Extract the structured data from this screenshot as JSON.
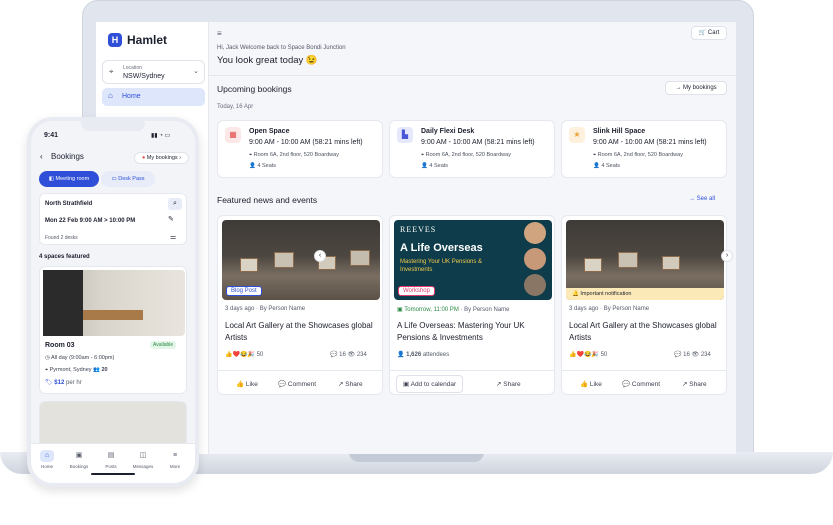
{
  "sidebar": {
    "app_name": "Hamlet",
    "logo_letter": "H",
    "location_label": "Location",
    "location_value": "NSW/Sydney",
    "nav_home": "Home"
  },
  "header": {
    "cart_label": "Cart",
    "greeting": "Hi, Jack Welcome back to Space Bondi Junction",
    "tagline": "You look great today 😉"
  },
  "bookings": {
    "title": "Upcoming bookings",
    "my_bookings": "My bookings",
    "date": "Today, 16 Apr",
    "items": [
      {
        "name": "Open Space",
        "time": "9:00 AM - 10:00 AM (58:21 mins left)",
        "room": "Room 6A, 2nd floor, 520 Boardway",
        "seats": "4 Seats",
        "icon": "building-icon",
        "color": "#e24b4b",
        "bg": "#fde8e8"
      },
      {
        "name": "Daily Flexi Desk",
        "time": "9:00 AM - 10:00 AM (58:21 mins left)",
        "room": "Room 6A, 2nd floor, 520 Boardway",
        "seats": "4 Seats",
        "icon": "desk-icon",
        "color": "#4a57d6",
        "bg": "#e6e8fb"
      },
      {
        "name": "Slink Hill Space",
        "time": "9:00 AM - 10:00 AM (58:21 mins left)",
        "room": "Room 6A, 2nd floor, 520 Boardway",
        "seats": "4 Seats",
        "icon": "star-icon",
        "color": "#e8a43a",
        "bg": "#fdf1de"
      }
    ]
  },
  "news": {
    "title": "Featured news and events",
    "see_all": "See all",
    "cards": [
      {
        "tag": "Blog Post",
        "meta": "3 days ago · By Person Name",
        "title": "Local Art Gallery at the Showcases global Artists",
        "reactions": "50",
        "comments": "16",
        "views": "234",
        "a1": "Like",
        "a2": "Comment",
        "a3": "Share"
      },
      {
        "tag": "Workshop",
        "meta_time": "Tomorrow, 11:00 PM",
        "meta": "· By Person Name",
        "title": "A Life Overseas: Mastering Your UK Pensions & Investments",
        "attendees": "1,626",
        "attendees_label": "attendees",
        "a1": "Add to calendar",
        "a2": "Share",
        "brand": "REEVES",
        "banner_title": "A Life Overseas",
        "banner_sub": "Mastering Your UK Pensions & Investments"
      },
      {
        "notice": "Important notification",
        "meta": "3 days ago · By Person Name",
        "title": "Local Art Gallery at the Showcases global Artists",
        "reactions": "50",
        "comments": "16",
        "views": "234",
        "a1": "Like",
        "a2": "Comment",
        "a3": "Share"
      }
    ]
  },
  "phone": {
    "time": "9:41",
    "title": "Bookings",
    "my_bookings": "My bookings",
    "tab_meeting": "Meeting room",
    "tab_desk": "Desk Pass",
    "store": "North Strathfield",
    "date_range": "Mon 22 Feb    9:00 AM > 10:00 PM",
    "found": "Found 2 desks",
    "featured": "4 spaces featured",
    "room": "Room 03",
    "available": "Available",
    "hours": "All day (9:00am - 6:00pm)",
    "place": "Pyrmont, Sydney",
    "capacity": "20",
    "price": "$12",
    "price_unit": "per hr",
    "nav": [
      "Home",
      "Bookings",
      "Posts",
      "Messages",
      "More"
    ]
  },
  "colors": {
    "accent": "#2f4fd8",
    "available": "#2a8a45",
    "workshop": "#e03a6f"
  }
}
